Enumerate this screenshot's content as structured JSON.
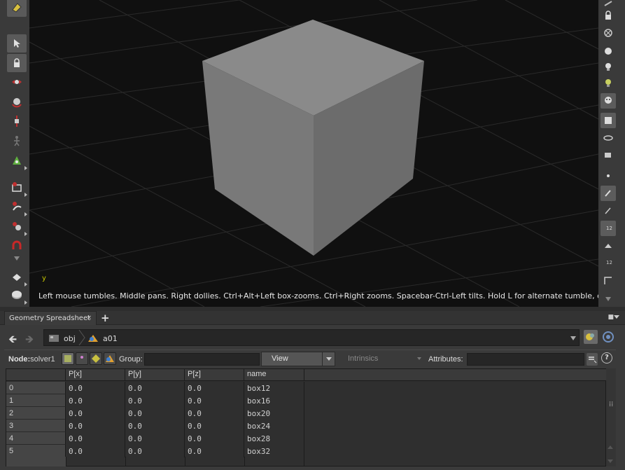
{
  "viewport": {
    "hint": "Left mouse tumbles. Middle pans. Right dollies. Ctrl+Alt+Left box-zooms. Ctrl+Right zooms. Spacebar-Ctrl-Left tilts. Hold L for alternate tumble, dolly, and zoom.",
    "axis_label": "y",
    "left_tools": [
      "select-icon",
      "lock-icon",
      "transform-icon",
      "rotate-icon",
      "scale-icon",
      "handle-icon",
      "pose-icon",
      "camera-icon",
      "brush-icon",
      "magnet-icon",
      "magnet-red-icon",
      "render-icon",
      "disk-icon"
    ],
    "right_tools": [
      "lock-icon",
      "bulb-icon",
      "ghost-icon",
      "display-icon",
      "point-icon",
      "wire-icon",
      "number-icon"
    ]
  },
  "tabbar": {
    "tab_label": "Geometry Spreadsheet",
    "close": "×",
    "add": "+"
  },
  "pathbar": {
    "root": "obj",
    "node": "a01"
  },
  "filterbar": {
    "node_label": "Node:",
    "node_value": "solver1",
    "group_label": "Group:",
    "view_label": "View",
    "intrinsics_label": "Intrinsics",
    "attributes_label": "Attributes:",
    "help": "?"
  },
  "sheet": {
    "columns": [
      "",
      "P[x]",
      "P[y]",
      "P[z]",
      "name"
    ],
    "rows": [
      [
        "0",
        "0.0",
        "0.0",
        "0.0",
        "box12"
      ],
      [
        "1",
        "0.0",
        "0.0",
        "0.0",
        "box16"
      ],
      [
        "2",
        "0.0",
        "0.0",
        "0.0",
        "box20"
      ],
      [
        "3",
        "0.0",
        "0.0",
        "0.0",
        "box24"
      ],
      [
        "4",
        "0.0",
        "0.0",
        "0.0",
        "box28"
      ],
      [
        "5",
        "0.0",
        "0.0",
        "0.0",
        "box32"
      ]
    ]
  }
}
